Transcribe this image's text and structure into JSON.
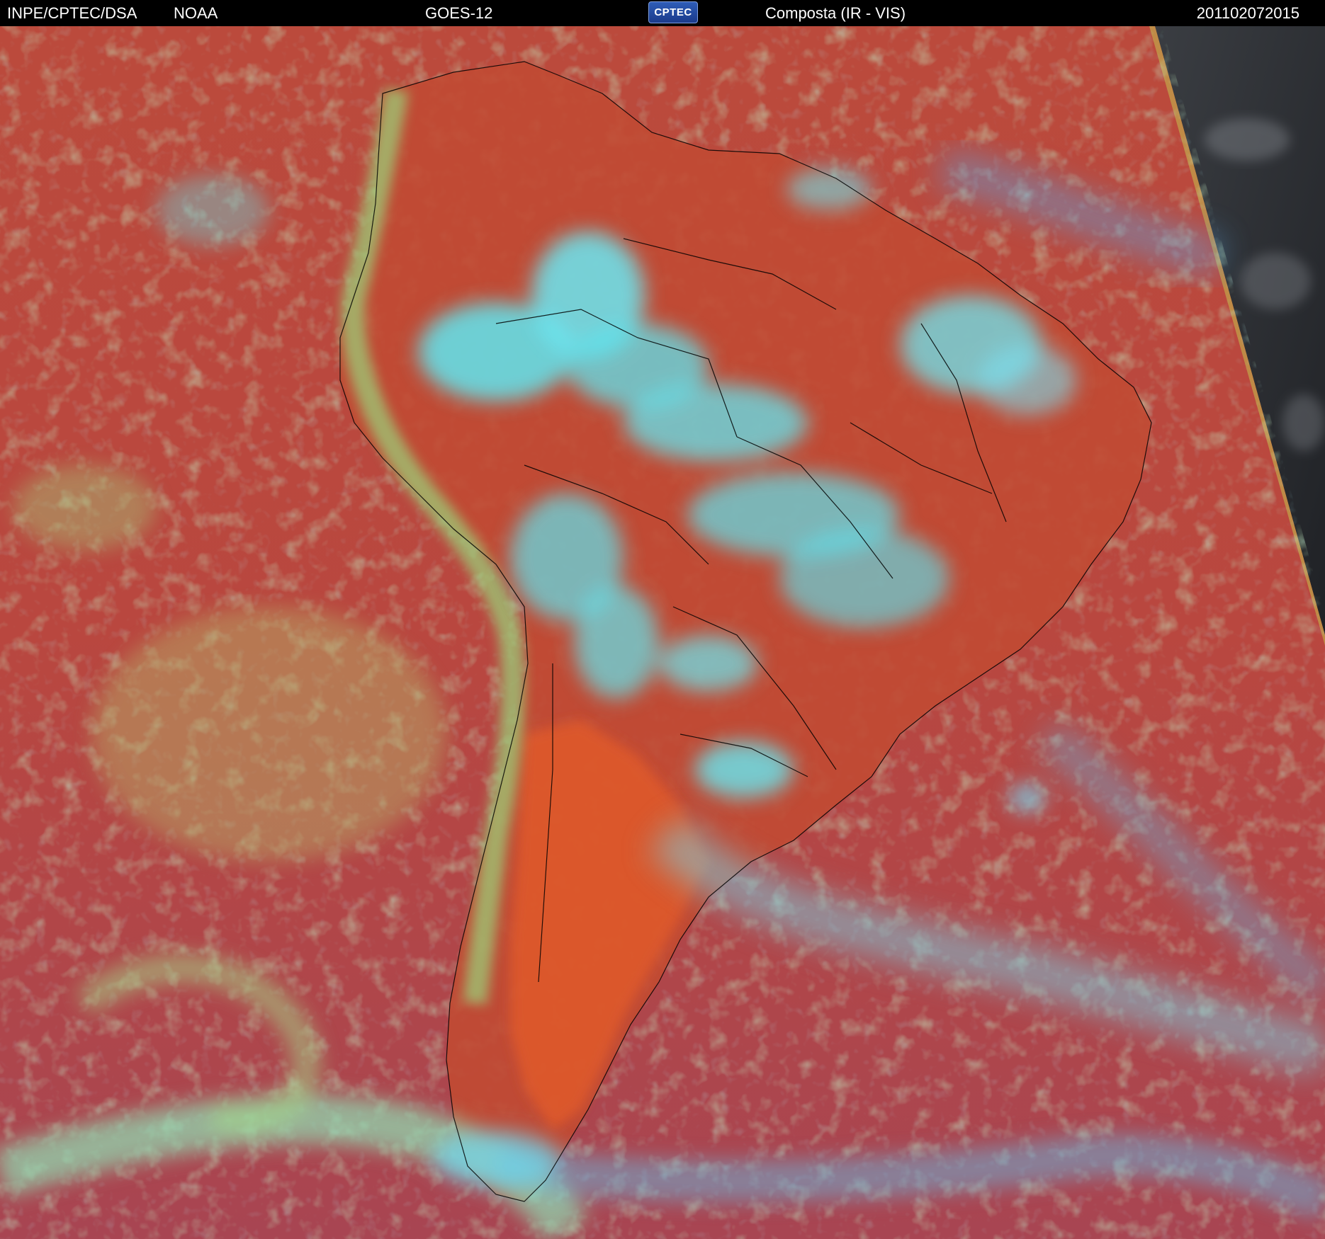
{
  "header": {
    "agency": "INPE/CPTEC/DSA",
    "partner": "NOAA",
    "satellite": "GOES-12",
    "logo_text": "CPTEC",
    "product": "Composta (IR - VIS)",
    "timestamp": "201102072015"
  },
  "image": {
    "description_icon": "satellite-composite-image",
    "colors": {
      "clear_sky": "#b7493f",
      "clear_land_hot": "#e05a2c",
      "high_cloud": "#5fe3ee",
      "low_cloud": "#8fd08a",
      "outside_scan": "#2b2e33",
      "coastline": "#000000"
    }
  }
}
